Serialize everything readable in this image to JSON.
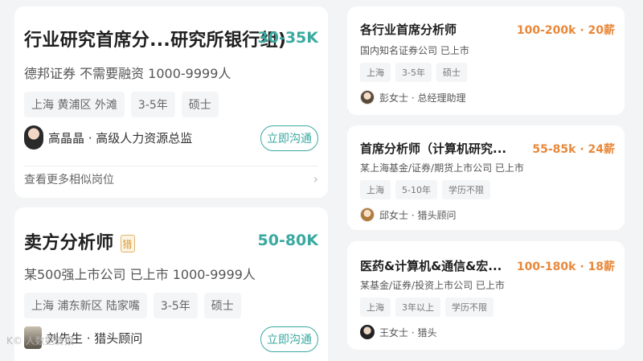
{
  "left": {
    "card1": {
      "title": "行业研究首席分...研究所银行组)",
      "salary": "30-35K",
      "company": "德邦证券 不需要融资 1000-9999人",
      "tags": [
        "上海 黄浦区 外滩",
        "3-5年",
        "硕士"
      ],
      "hr": "高晶晶 · 高级人力资源总监",
      "chat_label": "立即沟通",
      "more_label": "查看更多相似岗位",
      "chevron": "›"
    },
    "card2": {
      "title": "卖方分析师",
      "badge": "猎",
      "salary": "50-80K",
      "company": "某500强上市公司 已上市 1000-9999人",
      "tags": [
        "上海 浦东新区 陆家嘴",
        "3-5年",
        "硕士"
      ],
      "hr": "刘先生 · 猎头顾问",
      "chat_label": "立即沟通"
    }
  },
  "right": {
    "card1": {
      "title": "各行业首席分析师",
      "salary": "100-200k · 20薪",
      "company": "国内知名证券公司 已上市",
      "tags": [
        "上海",
        "3-5年",
        "硕士"
      ],
      "hr": "彭女士 · 总经理助理"
    },
    "card2": {
      "title": "首席分析师（计算机研究...",
      "salary": "55-85k · 24薪",
      "company": "某上海基金/证券/期货上市公司 已上市",
      "tags": [
        "上海",
        "5-10年",
        "学历不限"
      ],
      "hr": "邱女士 · 猎头顾问"
    },
    "card3": {
      "title": "医药&计算机&通信&宏...",
      "salary": "100-180k · 18薪",
      "company": "某基金/证券/投资上市公司 已上市",
      "tags": [
        "上海",
        "3年以上",
        "学历不限"
      ],
      "hr": "王女士 · 猎头"
    }
  },
  "watermark": "K© 人数据情报",
  "colors": {
    "accent_teal": "#3aa9a0",
    "salary_orange": "#e8883a"
  }
}
